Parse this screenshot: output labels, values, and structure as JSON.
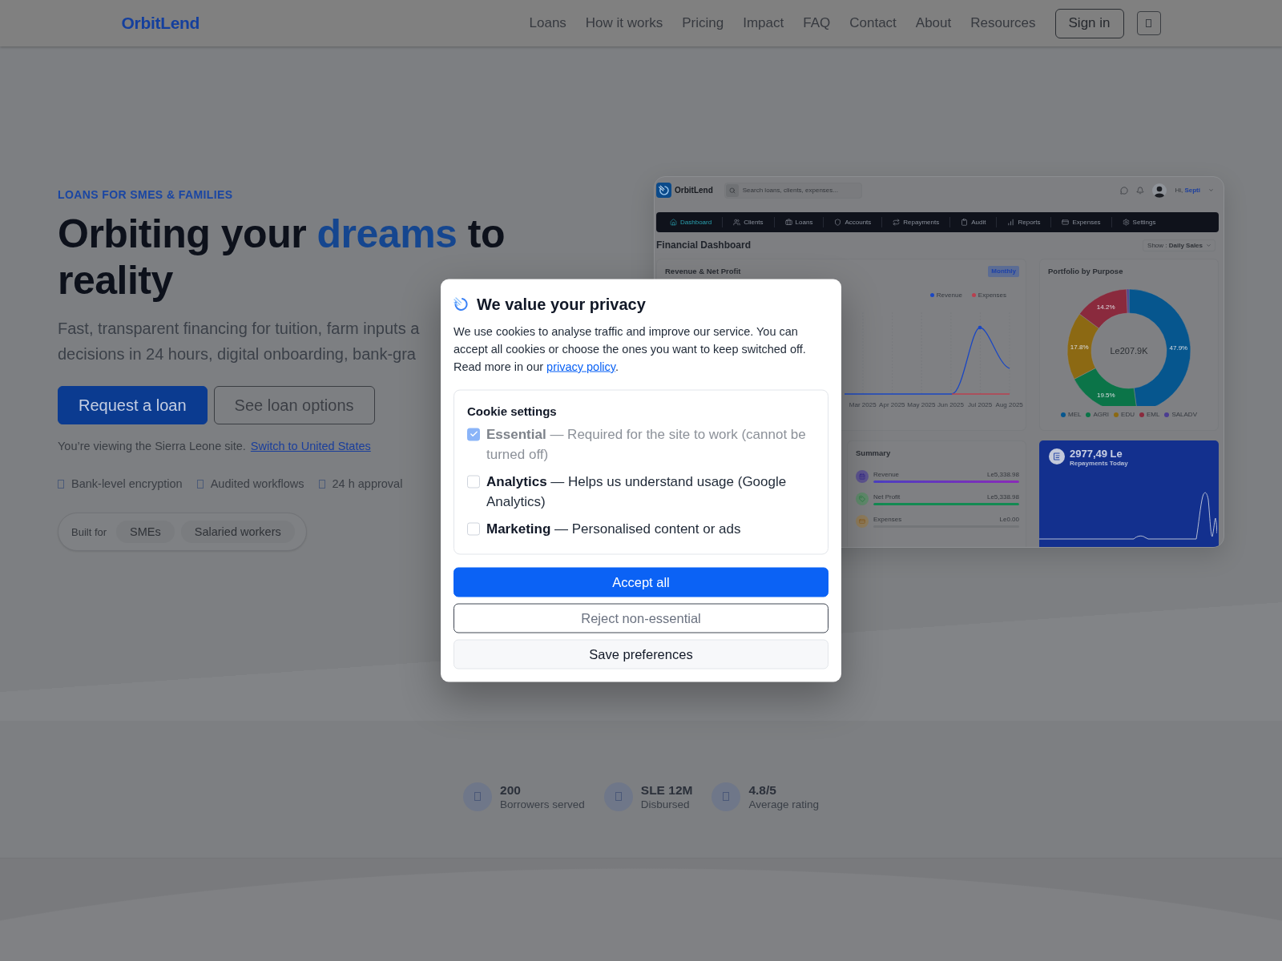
{
  "nav": {
    "logo": "OrbitLend",
    "links": [
      "Loans",
      "How it works",
      "Pricing",
      "Impact",
      "FAQ",
      "Contact",
      "About",
      "Resources"
    ],
    "sign_in": "Sign in"
  },
  "hero": {
    "eyebrow": "LOANS FOR SMES & FAMILIES",
    "heading": {
      "before": "Orbiting your ",
      "highlight": "dreams",
      "after": " to reality"
    },
    "subtitle_lines": [
      "Fast, transparent financing for tuition, farm inputs a",
      "decisions in 24 hours, digital onboarding, bank-gra"
    ],
    "buttons": [
      {
        "label": "Request a loan",
        "kind": "primary"
      },
      {
        "label": "See loan options",
        "kind": "outline"
      }
    ],
    "site_note": {
      "text": "You’re viewing the Sierra Leone site.",
      "link": "Switch to United States"
    },
    "features": [
      "Bank-level encryption",
      "Audited workflows",
      "24 h approval"
    ],
    "audience": {
      "label": "Built for",
      "chips": [
        "SMEs",
        "Salaried workers"
      ]
    }
  },
  "dashboard": {
    "logo": "OrbitLend",
    "search": {
      "placeholder": "Search loans, clients, expenses..."
    },
    "greeting": "Hi, **Septi**",
    "menu": [
      {
        "label": "Dashboard",
        "selected": true
      },
      {
        "label": "Clients",
        "selected": false
      },
      {
        "label": "Loans",
        "selected": false
      },
      {
        "label": "Accounts",
        "selected": false
      },
      {
        "label": "Repayments",
        "selected": false
      },
      {
        "label": "Audit",
        "selected": false
      },
      {
        "label": "Reports",
        "selected": false
      },
      {
        "label": "Expenses",
        "selected": false
      },
      {
        "label": "Settings",
        "selected": false
      }
    ],
    "title": "Financial Dashboard",
    "view_select": "Show : **Daily Sales**",
    "revenue_card": {
      "title": "Revenue & Net Profit",
      "badge": "Monthly",
      "legend": [
        {
          "label": "Revenue",
          "color": "#1b47c2"
        },
        {
          "label": "Expenses",
          "color": "#b8404f"
        }
      ],
      "months": [
        "Mar 2025",
        "Apr 2025",
        "May 2025",
        "Jun 2025",
        "Jul 2025",
        "Aug 2025"
      ]
    },
    "portfolio_card": {
      "total": "Le207.9K",
      "chart_data": {
        "type": "donut",
        "title": "Portfolio by Purpose",
        "categories": [
          "MEL",
          "AGRI",
          "EDU",
          "EML",
          "SALADV"
        ],
        "values": [
          47.9,
          19.5,
          17.8,
          14.2,
          0.6
        ],
        "colors": [
          "#06568e",
          "#0b7448",
          "#8c6913",
          "#8a2a3d",
          "#4c3d91"
        ],
        "value_labels": [
          "47.9%",
          "19.5%",
          "17.8%",
          "14.2%",
          null
        ],
        "legend": "bottom"
      }
    },
    "summary_card": {
      "title": "Summary",
      "rows": [
        {
          "kind": "revenue",
          "label": "Revenue",
          "value": "Le5,338.98",
          "level": 1
        },
        {
          "kind": "profit",
          "label": "Net Profit",
          "value": "Le5,338.98",
          "level": 1
        },
        {
          "kind": "expense",
          "label": "Expenses",
          "value": "Le0.00",
          "level": 0
        }
      ]
    },
    "repayments_card": {
      "amount": "2977,49 Le",
      "label": "Repayments Today"
    }
  },
  "stats": [
    {
      "value": "200",
      "label": "Borrowers served"
    },
    {
      "value": "SLE 12M",
      "label": "Disbursed"
    },
    {
      "value": "4.8/5",
      "label": "Average rating"
    }
  ],
  "cookie_dialog": {
    "title": "We value your privacy",
    "text": "We use cookies to analyse traffic and improve our service. You can accept all cookies or choose the ones you want to keep switched off. Read more in our ",
    "link": "privacy policy",
    "text_end": ".",
    "settings_title": "Cookie settings",
    "options": [
      {
        "label": "**Essential** — Required for the site to work (cannot be turned off)",
        "checked": true,
        "disabled": true
      },
      {
        "label": "**Analytics** — Helps us understand usage (Google Analytics)",
        "checked": false,
        "disabled": false
      },
      {
        "label": "**Marketing** — Personalised content or ads",
        "checked": false,
        "disabled": false
      }
    ],
    "buttons": [
      {
        "label": "Accept all",
        "kind": "primary"
      },
      {
        "label": "Reject non-essential",
        "kind": "outline"
      },
      {
        "label": "Save preferences",
        "kind": "secondary"
      }
    ]
  }
}
